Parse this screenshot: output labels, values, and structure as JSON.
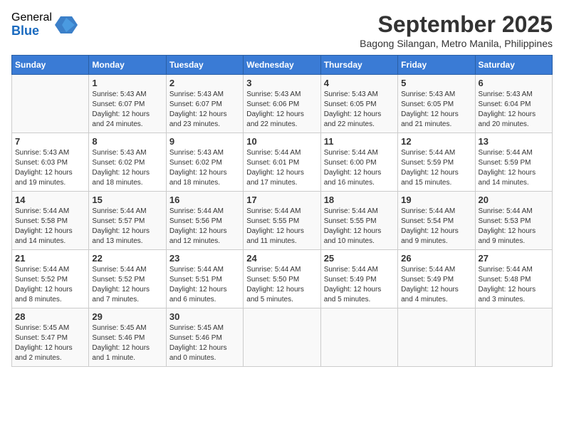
{
  "logo": {
    "general": "General",
    "blue": "Blue"
  },
  "title": "September 2025",
  "subtitle": "Bagong Silangan, Metro Manila, Philippines",
  "headers": [
    "Sunday",
    "Monday",
    "Tuesday",
    "Wednesday",
    "Thursday",
    "Friday",
    "Saturday"
  ],
  "weeks": [
    [
      {
        "day": "",
        "sunrise": "",
        "sunset": "",
        "daylight": ""
      },
      {
        "day": "1",
        "sunrise": "Sunrise: 5:43 AM",
        "sunset": "Sunset: 6:07 PM",
        "daylight": "Daylight: 12 hours and 24 minutes."
      },
      {
        "day": "2",
        "sunrise": "Sunrise: 5:43 AM",
        "sunset": "Sunset: 6:07 PM",
        "daylight": "Daylight: 12 hours and 23 minutes."
      },
      {
        "day": "3",
        "sunrise": "Sunrise: 5:43 AM",
        "sunset": "Sunset: 6:06 PM",
        "daylight": "Daylight: 12 hours and 22 minutes."
      },
      {
        "day": "4",
        "sunrise": "Sunrise: 5:43 AM",
        "sunset": "Sunset: 6:05 PM",
        "daylight": "Daylight: 12 hours and 22 minutes."
      },
      {
        "day": "5",
        "sunrise": "Sunrise: 5:43 AM",
        "sunset": "Sunset: 6:05 PM",
        "daylight": "Daylight: 12 hours and 21 minutes."
      },
      {
        "day": "6",
        "sunrise": "Sunrise: 5:43 AM",
        "sunset": "Sunset: 6:04 PM",
        "daylight": "Daylight: 12 hours and 20 minutes."
      }
    ],
    [
      {
        "day": "7",
        "sunrise": "Sunrise: 5:43 AM",
        "sunset": "Sunset: 6:03 PM",
        "daylight": "Daylight: 12 hours and 19 minutes."
      },
      {
        "day": "8",
        "sunrise": "Sunrise: 5:43 AM",
        "sunset": "Sunset: 6:02 PM",
        "daylight": "Daylight: 12 hours and 18 minutes."
      },
      {
        "day": "9",
        "sunrise": "Sunrise: 5:43 AM",
        "sunset": "Sunset: 6:02 PM",
        "daylight": "Daylight: 12 hours and 18 minutes."
      },
      {
        "day": "10",
        "sunrise": "Sunrise: 5:44 AM",
        "sunset": "Sunset: 6:01 PM",
        "daylight": "Daylight: 12 hours and 17 minutes."
      },
      {
        "day": "11",
        "sunrise": "Sunrise: 5:44 AM",
        "sunset": "Sunset: 6:00 PM",
        "daylight": "Daylight: 12 hours and 16 minutes."
      },
      {
        "day": "12",
        "sunrise": "Sunrise: 5:44 AM",
        "sunset": "Sunset: 5:59 PM",
        "daylight": "Daylight: 12 hours and 15 minutes."
      },
      {
        "day": "13",
        "sunrise": "Sunrise: 5:44 AM",
        "sunset": "Sunset: 5:59 PM",
        "daylight": "Daylight: 12 hours and 14 minutes."
      }
    ],
    [
      {
        "day": "14",
        "sunrise": "Sunrise: 5:44 AM",
        "sunset": "Sunset: 5:58 PM",
        "daylight": "Daylight: 12 hours and 14 minutes."
      },
      {
        "day": "15",
        "sunrise": "Sunrise: 5:44 AM",
        "sunset": "Sunset: 5:57 PM",
        "daylight": "Daylight: 12 hours and 13 minutes."
      },
      {
        "day": "16",
        "sunrise": "Sunrise: 5:44 AM",
        "sunset": "Sunset: 5:56 PM",
        "daylight": "Daylight: 12 hours and 12 minutes."
      },
      {
        "day": "17",
        "sunrise": "Sunrise: 5:44 AM",
        "sunset": "Sunset: 5:55 PM",
        "daylight": "Daylight: 12 hours and 11 minutes."
      },
      {
        "day": "18",
        "sunrise": "Sunrise: 5:44 AM",
        "sunset": "Sunset: 5:55 PM",
        "daylight": "Daylight: 12 hours and 10 minutes."
      },
      {
        "day": "19",
        "sunrise": "Sunrise: 5:44 AM",
        "sunset": "Sunset: 5:54 PM",
        "daylight": "Daylight: 12 hours and 9 minutes."
      },
      {
        "day": "20",
        "sunrise": "Sunrise: 5:44 AM",
        "sunset": "Sunset: 5:53 PM",
        "daylight": "Daylight: 12 hours and 9 minutes."
      }
    ],
    [
      {
        "day": "21",
        "sunrise": "Sunrise: 5:44 AM",
        "sunset": "Sunset: 5:52 PM",
        "daylight": "Daylight: 12 hours and 8 minutes."
      },
      {
        "day": "22",
        "sunrise": "Sunrise: 5:44 AM",
        "sunset": "Sunset: 5:52 PM",
        "daylight": "Daylight: 12 hours and 7 minutes."
      },
      {
        "day": "23",
        "sunrise": "Sunrise: 5:44 AM",
        "sunset": "Sunset: 5:51 PM",
        "daylight": "Daylight: 12 hours and 6 minutes."
      },
      {
        "day": "24",
        "sunrise": "Sunrise: 5:44 AM",
        "sunset": "Sunset: 5:50 PM",
        "daylight": "Daylight: 12 hours and 5 minutes."
      },
      {
        "day": "25",
        "sunrise": "Sunrise: 5:44 AM",
        "sunset": "Sunset: 5:49 PM",
        "daylight": "Daylight: 12 hours and 5 minutes."
      },
      {
        "day": "26",
        "sunrise": "Sunrise: 5:44 AM",
        "sunset": "Sunset: 5:49 PM",
        "daylight": "Daylight: 12 hours and 4 minutes."
      },
      {
        "day": "27",
        "sunrise": "Sunrise: 5:44 AM",
        "sunset": "Sunset: 5:48 PM",
        "daylight": "Daylight: 12 hours and 3 minutes."
      }
    ],
    [
      {
        "day": "28",
        "sunrise": "Sunrise: 5:45 AM",
        "sunset": "Sunset: 5:47 PM",
        "daylight": "Daylight: 12 hours and 2 minutes."
      },
      {
        "day": "29",
        "sunrise": "Sunrise: 5:45 AM",
        "sunset": "Sunset: 5:46 PM",
        "daylight": "Daylight: 12 hours and 1 minute."
      },
      {
        "day": "30",
        "sunrise": "Sunrise: 5:45 AM",
        "sunset": "Sunset: 5:46 PM",
        "daylight": "Daylight: 12 hours and 0 minutes."
      },
      {
        "day": "",
        "sunrise": "",
        "sunset": "",
        "daylight": ""
      },
      {
        "day": "",
        "sunrise": "",
        "sunset": "",
        "daylight": ""
      },
      {
        "day": "",
        "sunrise": "",
        "sunset": "",
        "daylight": ""
      },
      {
        "day": "",
        "sunrise": "",
        "sunset": "",
        "daylight": ""
      }
    ]
  ]
}
